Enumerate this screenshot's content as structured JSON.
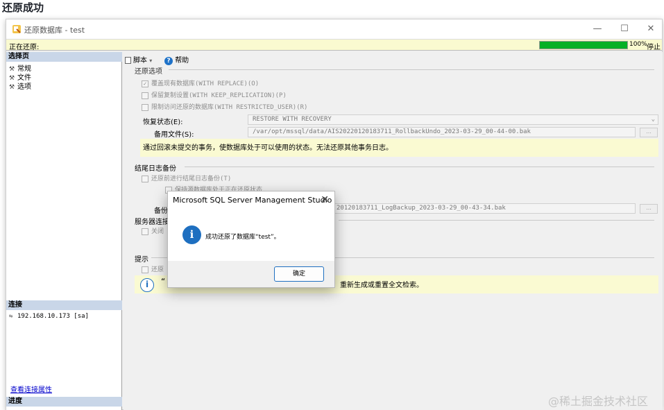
{
  "page": {
    "heading": "还原成功",
    "watermark": "@稀土掘金技术社区"
  },
  "window": {
    "title": "还原数据库 - test",
    "min_glyph": "—",
    "max_glyph": "☐",
    "close_glyph": "✕",
    "status_text": "正在还原:",
    "progress_pct": 100,
    "progress_label": "100%",
    "stop_label": "停止"
  },
  "left": {
    "select_page_header": "选择页",
    "pages": [
      "常规",
      "文件",
      "选项"
    ],
    "connection_header": "连接",
    "connection_value": "192.168.10.173 [sa]",
    "view_conn_link": "查看连接属性",
    "progress_header": "进度"
  },
  "toolbar": {
    "script_label": "脚本",
    "help_label": "帮助"
  },
  "restore_options": {
    "title": "还原选项",
    "options": [
      {
        "label": "覆盖现有数据库(WITH REPLACE)(O)",
        "checked": true
      },
      {
        "label": "保留复制设置(WITH KEEP_REPLICATION)(P)",
        "checked": false
      },
      {
        "label": "限制访问还原的数据库(WITH RESTRICTED_USER)(R)",
        "checked": false
      }
    ],
    "recovery_state_label": "恢复状态(E):",
    "recovery_state_value": "RESTORE WITH RECOVERY",
    "standby_label": "备用文件(S):",
    "standby_value": "/var/opt/mssql/data/AIS20220120183711_RollbackUndo_2023-03-29_00-44-00.bak",
    "browse_label": "...",
    "recovery_info": "通过回滚未提交的事务，使数据库处于可以使用的状态。无法还原其他事务日志。"
  },
  "tail_log": {
    "title": "结尾日志备份",
    "option1": "还原前进行结尾日志备份(T)",
    "option2": "保持源数据库处于正在还原状态",
    "backup_label": "备份",
    "backup_value": "20120183711_LogBackup_2023-03-29_00-43-34.bak"
  },
  "server_conn": {
    "title": "服务器连接",
    "option1": "关闭"
  },
  "hint": {
    "title": "提示",
    "option1": "还原",
    "info_quote": "“",
    "info_text": "重新生成或重置全文检索。"
  },
  "dialog": {
    "title": "Microsoft SQL Server Management Studio",
    "close_glyph": "✕",
    "message": "成功还原了数据库“test”。",
    "ok_label": "确定"
  }
}
